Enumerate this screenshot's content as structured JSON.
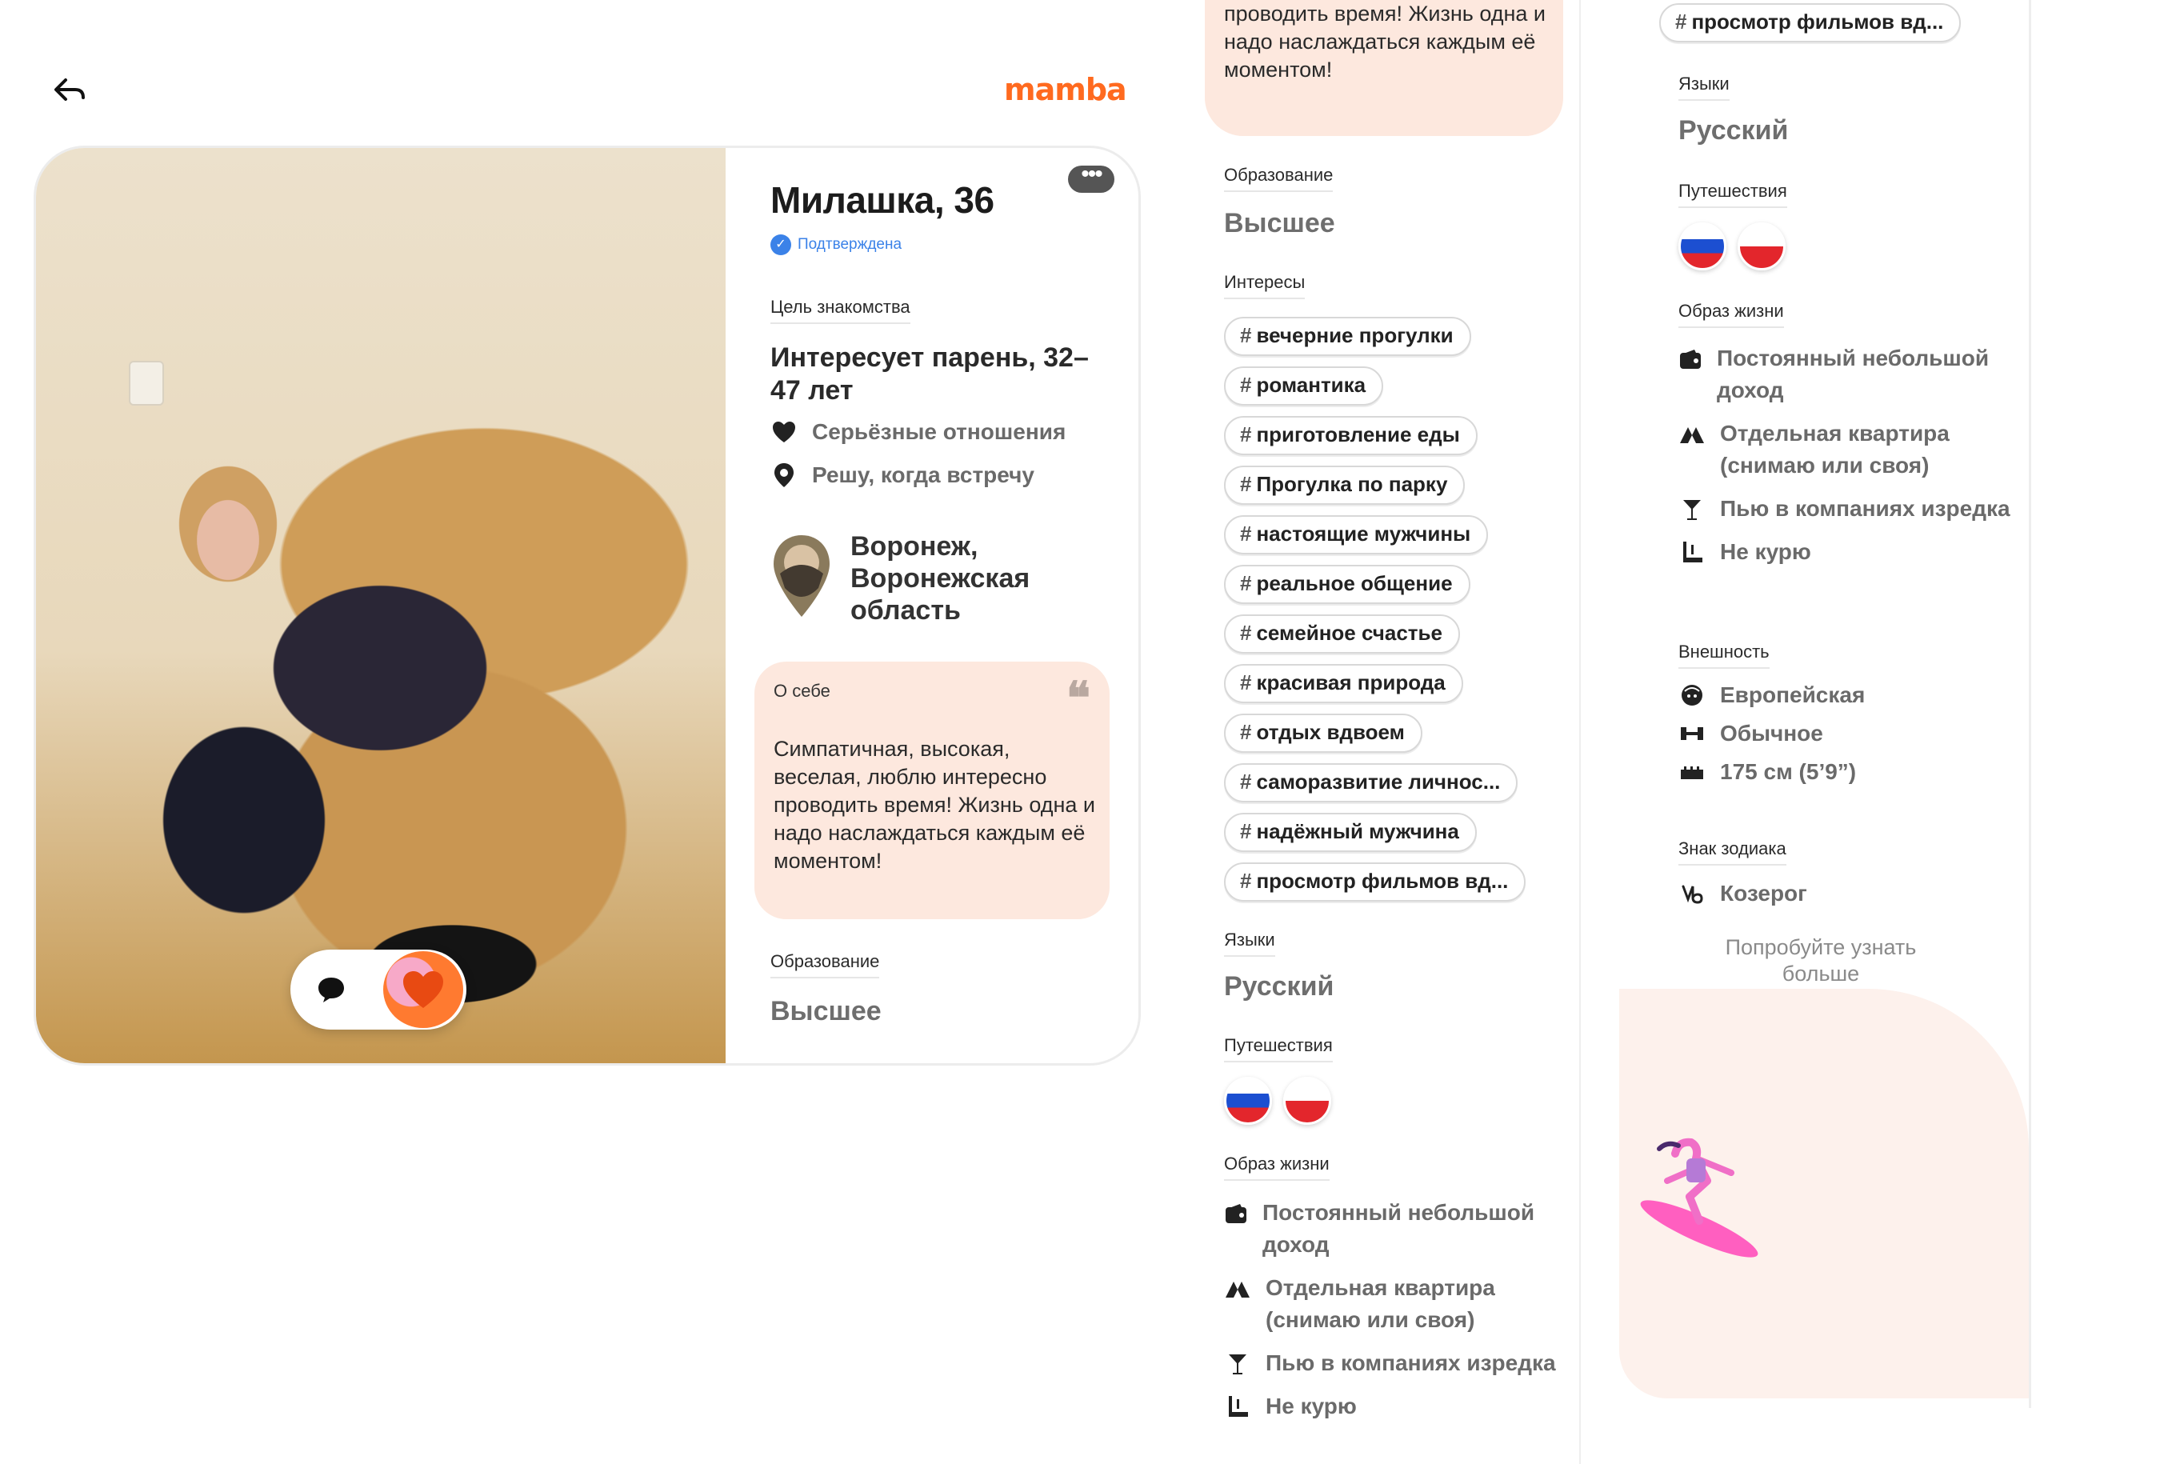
{
  "header": {
    "back_icon": "back-arrow-icon",
    "logo": "mamba"
  },
  "profile": {
    "name_age": "Милашка, 36",
    "verified": "Подтверждена",
    "goal": {
      "label": "Цель знакомства",
      "value": "Интересует парень, 32–47 лет",
      "relationship": "Серьёзные отношения",
      "meeting": "Решу, когда встречу"
    },
    "location": "Воронеж, Воронежская область",
    "about": {
      "label": "О себе",
      "text": "Симпатичная, высокая, веселая, люблю интересно проводить время! Жизнь одна и надо наслаждаться каждым её моментом!",
      "text_tail": "проводить время! Жизнь одна и надо наслаждаться каждым её моментом!"
    },
    "education": {
      "label": "Образование",
      "value": "Высшее"
    },
    "interests": {
      "label": "Интересы",
      "tags": [
        "вечерние прогулки",
        "романтика",
        "приготовление еды",
        "Прогулка по парку",
        "настоящие мужчины",
        "реальное общение",
        "семейное счастье",
        "красивая природа",
        "отдых вдвоем",
        "саморазвитие личнос...",
        "надёжный мужчина",
        "просмотр фильмов вд..."
      ]
    },
    "languages": {
      "label": "Языки",
      "value": "Русский"
    },
    "travel": {
      "label": "Путешествия",
      "flags": [
        "russia-flag",
        "poland-flag"
      ]
    },
    "lifestyle": {
      "label": "Образ жизни",
      "items": [
        {
          "icon": "wallet-icon",
          "text": "Постоянный небольшой доход"
        },
        {
          "icon": "home-icon",
          "text": "Отдельная квартира (снимаю или своя)"
        },
        {
          "icon": "cocktail-icon",
          "text": "Пью в компаниях изредка"
        },
        {
          "icon": "no-smoking-icon",
          "text": "Не курю"
        }
      ]
    },
    "appearance": {
      "label": "Внешность",
      "items": [
        {
          "icon": "face-icon",
          "text": "Европейская"
        },
        {
          "icon": "dumbbell-icon",
          "text": "Обычное"
        },
        {
          "icon": "ruler-icon",
          "text": "175 см (5’9”)"
        }
      ]
    },
    "zodiac": {
      "label": "Знак зодиака",
      "value": "Козерог",
      "icon": "capricorn-icon"
    }
  },
  "footer": {
    "try_more": "Попробуйте узнать больше"
  },
  "colors": {
    "brand": "#ff6a1f",
    "verified": "#3b82e8",
    "about_bg": "#fde8de"
  }
}
